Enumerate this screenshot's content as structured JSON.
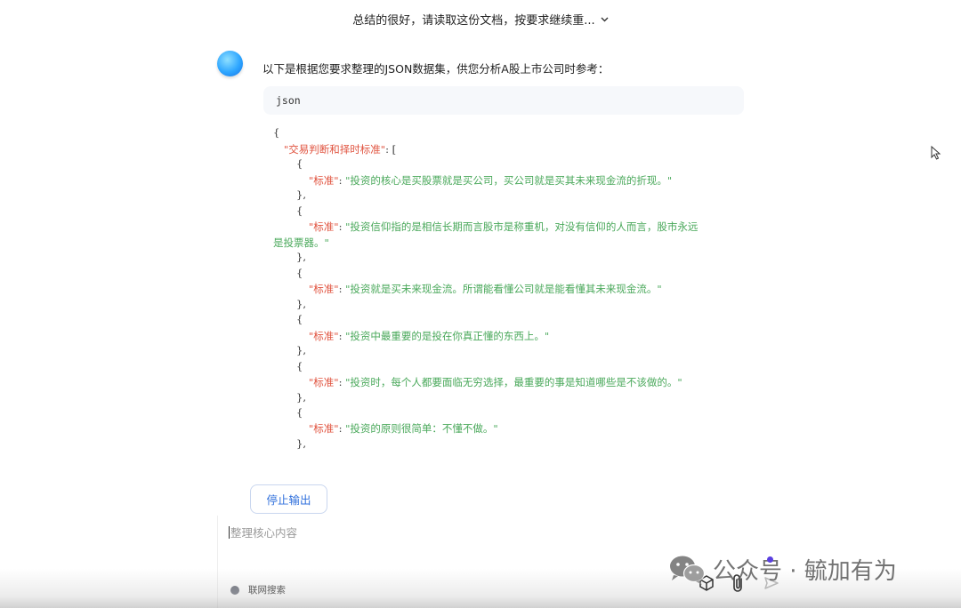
{
  "header": {
    "conversation_title": "总结的很好，请读取这份文档，按要求继续重..."
  },
  "message": {
    "intro": "以下是根据您要求整理的JSON数据集，供您分析A股上市公司时参考：",
    "code_lang": "json",
    "code_lines": {
      "l0": "{",
      "l1_key": "\"交易判断和择时标准\"",
      "l1_rest": ": [",
      "l2": "{",
      "item_key": "\"标准\"",
      "colon": ": ",
      "v1": "\"投资的核心是买股票就是买公司，买公司就是买其未来现金流的折现。\"",
      "v2a": "\"投资信仰指的是相信长期而言股市是称重机，对没有信仰的人而言，股市永远",
      "v2b": "是投票器。\"",
      "v3": "\"投资就是买未来现金流。所谓能看懂公司就是能看懂其未来现金流。\"",
      "v4": "\"投资中最重要的是投在你真正懂的东西上。\"",
      "v5": "\"投资时，每个人都要面临无穷选择，最重要的事是知道哪些是不该做的。\"",
      "v6": "\"投资的原则很简单：不懂不做。\"",
      "close": "},",
      "open": "{"
    }
  },
  "actions": {
    "stop_label": "停止输出"
  },
  "composer": {
    "placeholder": "整理核心内容",
    "web_search_label": "联网搜索"
  },
  "watermark": {
    "text": "公众号 · 毓加有为"
  },
  "colors": {
    "key": "#e0533f",
    "string": "#49a85a",
    "accent": "#2f6fdc"
  }
}
